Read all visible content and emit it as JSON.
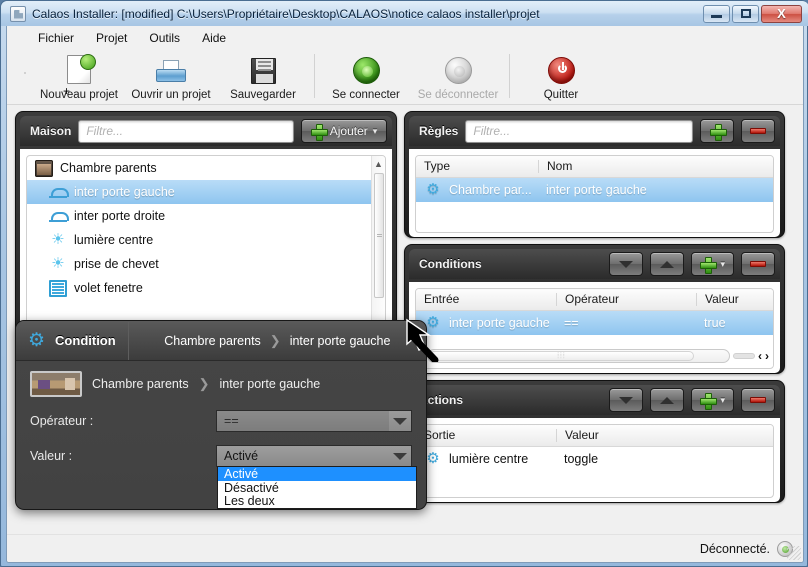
{
  "window": {
    "title": "Calaos Installer: [modified] C:\\Users\\Propriétaire\\Desktop\\CALAOS\\notice calaos installer\\projet",
    "app_icon": "app-icon",
    "minimize": "–",
    "maximize": "□",
    "close": "X"
  },
  "menu": {
    "items": [
      {
        "label": "Fichier"
      },
      {
        "label": "Projet"
      },
      {
        "label": "Outils"
      },
      {
        "label": "Aide"
      }
    ]
  },
  "toolbar": {
    "buttons": [
      {
        "label": "Nouveau projet",
        "icon": "new-document-icon",
        "disabled": false
      },
      {
        "label": "Ouvrir un projet",
        "icon": "open-folder-icon",
        "disabled": false
      },
      {
        "label": "Sauvegarder",
        "icon": "floppy-disk-icon",
        "disabled": false
      },
      {
        "label": "Se connecter",
        "icon": "green-power-icon",
        "disabled": false
      },
      {
        "label": "Se déconnecter",
        "icon": "grey-power-icon",
        "disabled": true
      },
      {
        "label": "Quitter",
        "icon": "red-power-icon",
        "disabled": false
      }
    ]
  },
  "maison": {
    "title": "Maison",
    "filter_placeholder": "Filtre...",
    "add_label": "Ajouter",
    "tree": [
      {
        "label": "Chambre parents",
        "icon": "room-icon",
        "level": 0,
        "selected": false
      },
      {
        "label": "inter porte gauche",
        "icon": "switch-icon",
        "level": 1,
        "selected": true
      },
      {
        "label": "inter porte droite",
        "icon": "switch-icon",
        "level": 1,
        "selected": false
      },
      {
        "label": "lumière centre",
        "icon": "light-icon",
        "level": 1,
        "selected": false
      },
      {
        "label": "prise de chevet",
        "icon": "light-icon",
        "level": 1,
        "selected": false
      },
      {
        "label": "volet fenetre",
        "icon": "shutter-icon",
        "level": 1,
        "selected": false
      }
    ],
    "tree_bottom": [
      {
        "label": "inter porte droite",
        "icon": "switch-icon",
        "level": 1,
        "selected": false
      }
    ]
  },
  "regles": {
    "title": "Règles",
    "filter_placeholder": "Filtre...",
    "add_icon": "green-plus-icon",
    "remove_icon": "red-minus-icon",
    "columns": [
      "Type",
      "Nom"
    ],
    "rows": [
      {
        "icon": "gear-icon",
        "type": "Chambre par...",
        "nom": "inter porte gauche",
        "selected": true
      }
    ]
  },
  "conditions": {
    "title": "Conditions",
    "move_down_icon": "triangle-down-icon",
    "move_up_icon": "triangle-up-icon",
    "add_icon": "green-plus-icon",
    "remove_icon": "red-minus-icon",
    "columns": [
      "Entrée",
      "Opérateur",
      "Valeur"
    ],
    "rows": [
      {
        "icon": "gear-icon",
        "entree": "inter porte gauche",
        "operateur": "==",
        "valeur": "true",
        "selected": true
      }
    ],
    "hscroll": {
      "left_arrow": "‹",
      "right_arrow": "›",
      "grip": "⦙⦙⦙"
    }
  },
  "actions": {
    "title": "Actions",
    "move_down_icon": "triangle-down-icon",
    "move_up_icon": "triangle-up-icon",
    "add_icon": "green-plus-icon",
    "remove_icon": "red-minus-icon",
    "columns": [
      "Sortie",
      "Valeur"
    ],
    "rows": [
      {
        "icon": "gear-icon",
        "sortie": "lumière centre",
        "valeur": "toggle",
        "selected": false
      }
    ]
  },
  "condition_dialog": {
    "gear_icon": "gear-icon",
    "title": "Condition",
    "breadcrumb_room": "Chambre parents",
    "breadcrumb_sep": "❯",
    "breadcrumb_item": "inter porte gauche",
    "thumb_icon": "room-thumbnail",
    "body_room": "Chambre parents",
    "body_item": "inter porte gauche",
    "operator_label": "Opérateur :",
    "operator_value": "==",
    "value_label": "Valeur :",
    "value_value": "Activé",
    "options": [
      {
        "label": "Activé",
        "selected": true
      },
      {
        "label": "Désactivé",
        "selected": false
      },
      {
        "label": "Les deux",
        "selected": false
      }
    ]
  },
  "status": {
    "text": "Déconnecté.",
    "led": "grey-green-led"
  },
  "colors": {
    "accent_blue": "#3fa9dd",
    "selection_blue": "#8ec5ef",
    "panel_dark": "#2b2b2b",
    "dialog_bg": "#434343",
    "dropdown_highlight": "#1e90ff",
    "green": "#2f8f11",
    "red": "#b01208"
  }
}
